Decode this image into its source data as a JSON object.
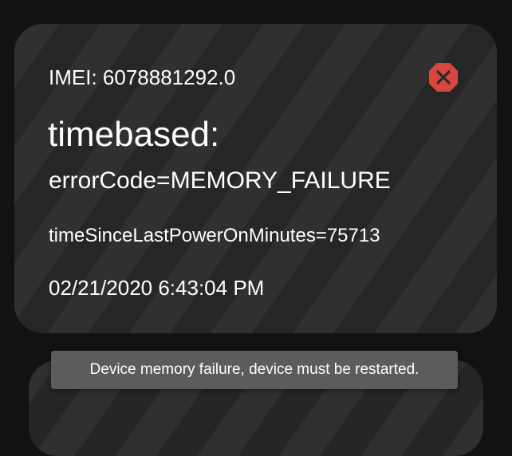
{
  "notification": {
    "imei": "IMEI: 6078881292.0",
    "heading": "timebased:",
    "error_code": "errorCode=MEMORY_FAILURE",
    "detail": "timeSinceLastPowerOnMinutes=75713",
    "timestamp": "02/21/2020 6:43:04 PM",
    "close_icon": "close-octagon-icon",
    "close_color": "#d9463e"
  },
  "toast": {
    "message": "Device memory failure, device must be restarted."
  },
  "colors": {
    "background": "#121212",
    "card": "#2c2c2c",
    "toast": "#5c5c5c",
    "text": "#ffffff"
  }
}
